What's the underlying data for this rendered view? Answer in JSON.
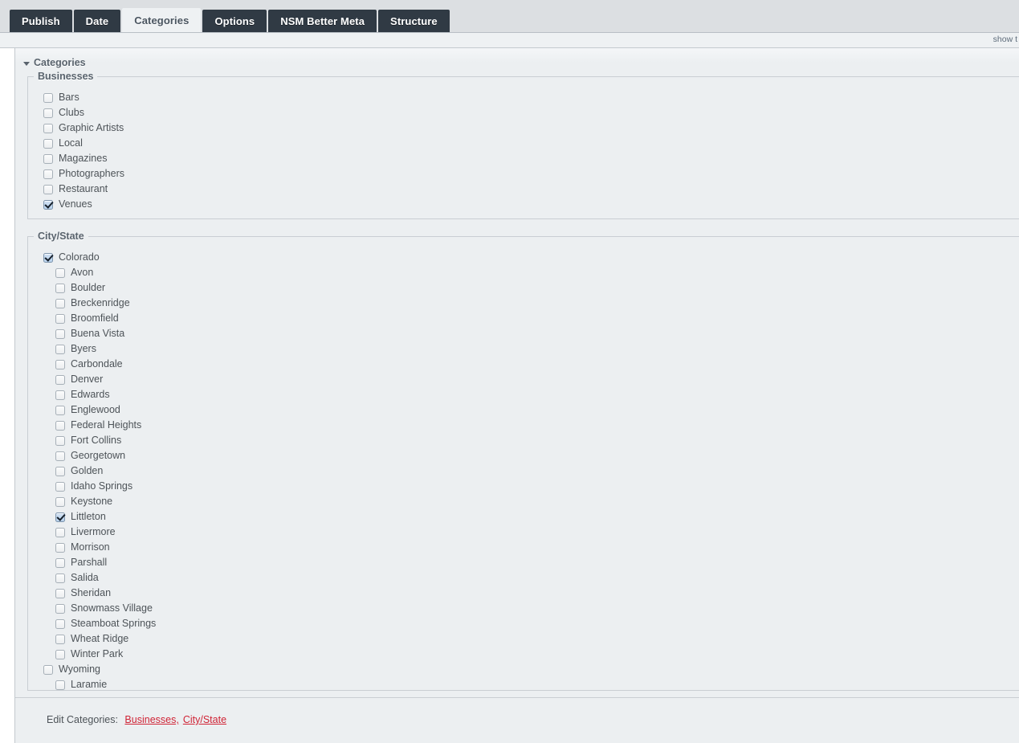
{
  "tabs": [
    {
      "label": "Publish",
      "active": false
    },
    {
      "label": "Date",
      "active": false
    },
    {
      "label": "Categories",
      "active": true
    },
    {
      "label": "Options",
      "active": false
    },
    {
      "label": "NSM Better Meta",
      "active": false
    },
    {
      "label": "Structure",
      "active": false
    }
  ],
  "subbar": {
    "show_tabs_label": "show t"
  },
  "panel": {
    "title": "Categories"
  },
  "groups": [
    {
      "legend": "Businesses",
      "items": [
        {
          "label": "Bars",
          "checked": false,
          "child": false
        },
        {
          "label": "Clubs",
          "checked": false,
          "child": false
        },
        {
          "label": "Graphic Artists",
          "checked": false,
          "child": false
        },
        {
          "label": "Local",
          "checked": false,
          "child": false
        },
        {
          "label": "Magazines",
          "checked": false,
          "child": false
        },
        {
          "label": "Photographers",
          "checked": false,
          "child": false
        },
        {
          "label": "Restaurant",
          "checked": false,
          "child": false
        },
        {
          "label": "Venues",
          "checked": true,
          "child": false
        }
      ]
    },
    {
      "legend": "City/State",
      "items": [
        {
          "label": "Colorado",
          "checked": true,
          "child": false
        },
        {
          "label": "Avon",
          "checked": false,
          "child": true
        },
        {
          "label": "Boulder",
          "checked": false,
          "child": true
        },
        {
          "label": "Breckenridge",
          "checked": false,
          "child": true
        },
        {
          "label": "Broomfield",
          "checked": false,
          "child": true
        },
        {
          "label": "Buena Vista",
          "checked": false,
          "child": true
        },
        {
          "label": "Byers",
          "checked": false,
          "child": true
        },
        {
          "label": "Carbondale",
          "checked": false,
          "child": true
        },
        {
          "label": "Denver",
          "checked": false,
          "child": true
        },
        {
          "label": "Edwards",
          "checked": false,
          "child": true
        },
        {
          "label": "Englewood",
          "checked": false,
          "child": true
        },
        {
          "label": "Federal Heights",
          "checked": false,
          "child": true
        },
        {
          "label": "Fort Collins",
          "checked": false,
          "child": true
        },
        {
          "label": "Georgetown",
          "checked": false,
          "child": true
        },
        {
          "label": "Golden",
          "checked": false,
          "child": true
        },
        {
          "label": "Idaho Springs",
          "checked": false,
          "child": true
        },
        {
          "label": "Keystone",
          "checked": false,
          "child": true
        },
        {
          "label": "Littleton",
          "checked": true,
          "child": true
        },
        {
          "label": "Livermore",
          "checked": false,
          "child": true
        },
        {
          "label": "Morrison",
          "checked": false,
          "child": true
        },
        {
          "label": "Parshall",
          "checked": false,
          "child": true
        },
        {
          "label": "Salida",
          "checked": false,
          "child": true
        },
        {
          "label": "Sheridan",
          "checked": false,
          "child": true
        },
        {
          "label": "Snowmass Village",
          "checked": false,
          "child": true
        },
        {
          "label": "Steamboat Springs",
          "checked": false,
          "child": true
        },
        {
          "label": "Wheat Ridge",
          "checked": false,
          "child": true
        },
        {
          "label": "Winter Park",
          "checked": false,
          "child": true
        },
        {
          "label": "Wyoming",
          "checked": false,
          "child": false
        },
        {
          "label": "Laramie",
          "checked": false,
          "child": true
        }
      ]
    }
  ],
  "footer": {
    "prefix": "Edit Categories:",
    "links": [
      {
        "label": "Businesses,"
      },
      {
        "label": "City/State"
      }
    ]
  },
  "colors": {
    "tab_inactive_bg": "#303a44",
    "tab_active_bg": "#eef1f3",
    "panel_bg": "#eceff1",
    "link_red": "#d02436",
    "checkbox_checked_bg": "#b9d2ec",
    "text": "#4d5358"
  }
}
